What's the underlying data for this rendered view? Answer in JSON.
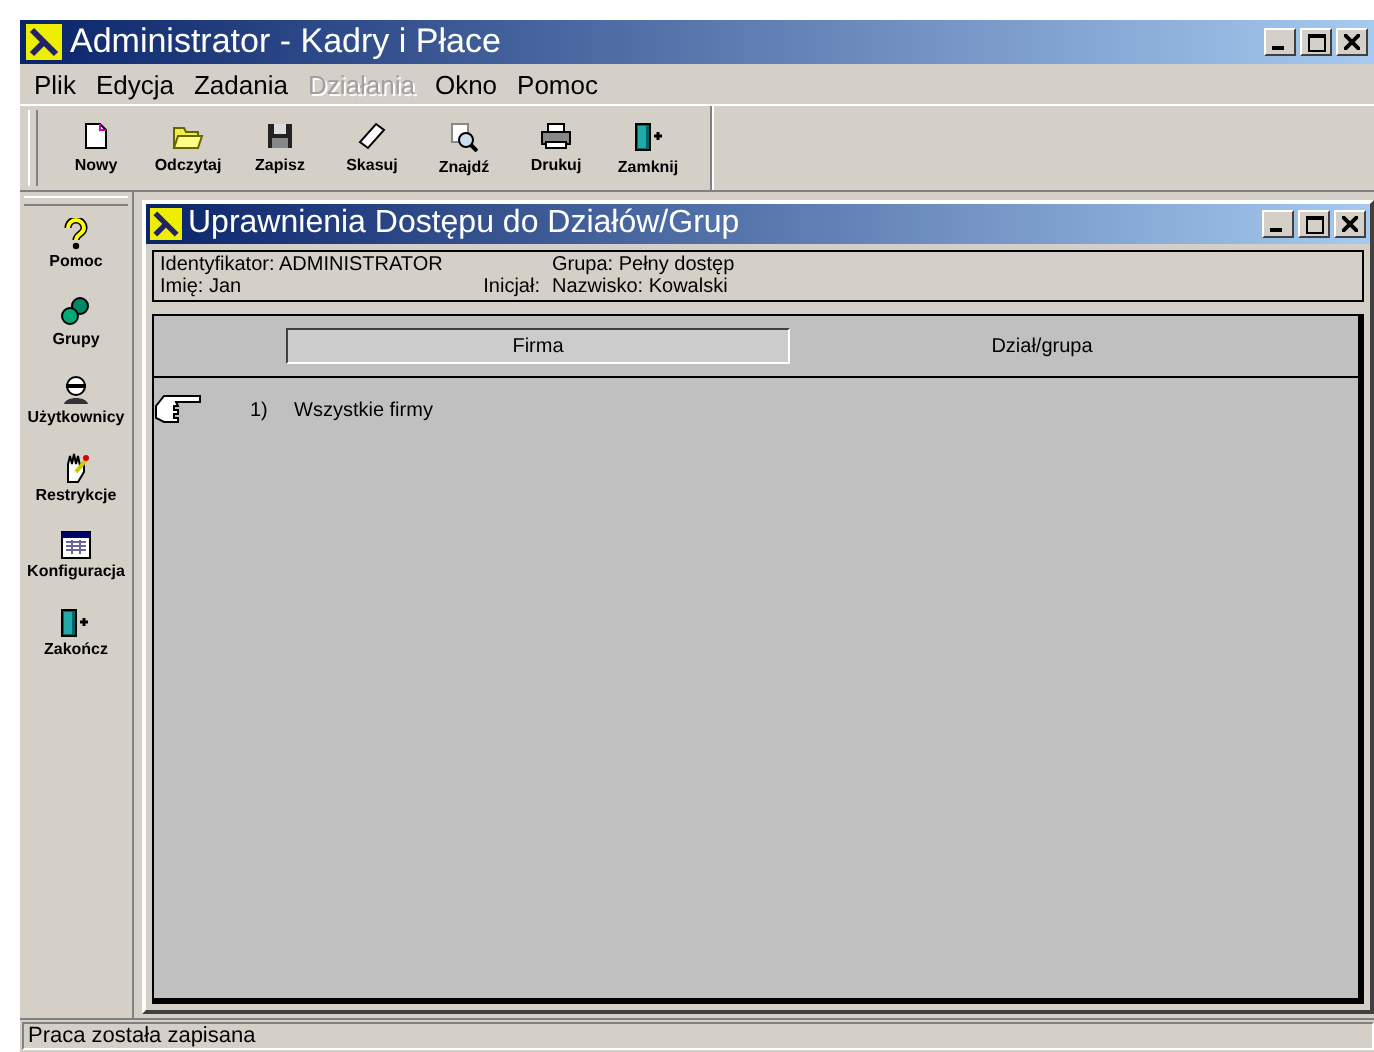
{
  "window": {
    "title": "Administrator - Kadry i Płace"
  },
  "menu": [
    {
      "label": "Plik",
      "disabled": false
    },
    {
      "label": "Edycja",
      "disabled": false
    },
    {
      "label": "Zadania",
      "disabled": false
    },
    {
      "label": "Działania",
      "disabled": true
    },
    {
      "label": "Okno",
      "disabled": false
    },
    {
      "label": "Pomoc",
      "disabled": false
    }
  ],
  "toolbar": [
    {
      "label": "Nowy",
      "kind": "new"
    },
    {
      "label": "Odczytaj",
      "kind": "open"
    },
    {
      "label": "Zapisz",
      "kind": "save"
    },
    {
      "label": "Skasuj",
      "kind": "erase"
    },
    {
      "label": "Znajdź",
      "kind": "find"
    },
    {
      "label": "Drukuj",
      "kind": "print"
    },
    {
      "label": "Zamknij",
      "kind": "exit"
    }
  ],
  "sidebar": {
    "items": [
      {
        "label": "Pomoc",
        "kind": "help"
      },
      {
        "label": "Grupy",
        "kind": "groups"
      },
      {
        "label": "Użytkownicy",
        "kind": "users"
      },
      {
        "label": "Restrykcje",
        "kind": "restrict"
      },
      {
        "label": "Konfiguracja",
        "kind": "config"
      },
      {
        "label": "Zakończ",
        "kind": "exit"
      }
    ]
  },
  "child_window": {
    "title": "Uprawnienia Dostępu do Działów/Grup",
    "info": {
      "identifier": "Identyfikator: ADMINISTRATOR",
      "group": "Grupa: Pełny dostęp",
      "first_name": "Imię: Jan",
      "initial": "Inicjał:",
      "last_name": "Nazwisko: Kowalski"
    },
    "tabs": [
      {
        "label": "Firma",
        "selected": true
      },
      {
        "label": "Dział/grupa",
        "selected": false
      }
    ],
    "rows": [
      {
        "number": "1)",
        "name": "Wszystkie firmy",
        "current": true
      }
    ]
  },
  "status_bar": "Praca została zapisana"
}
